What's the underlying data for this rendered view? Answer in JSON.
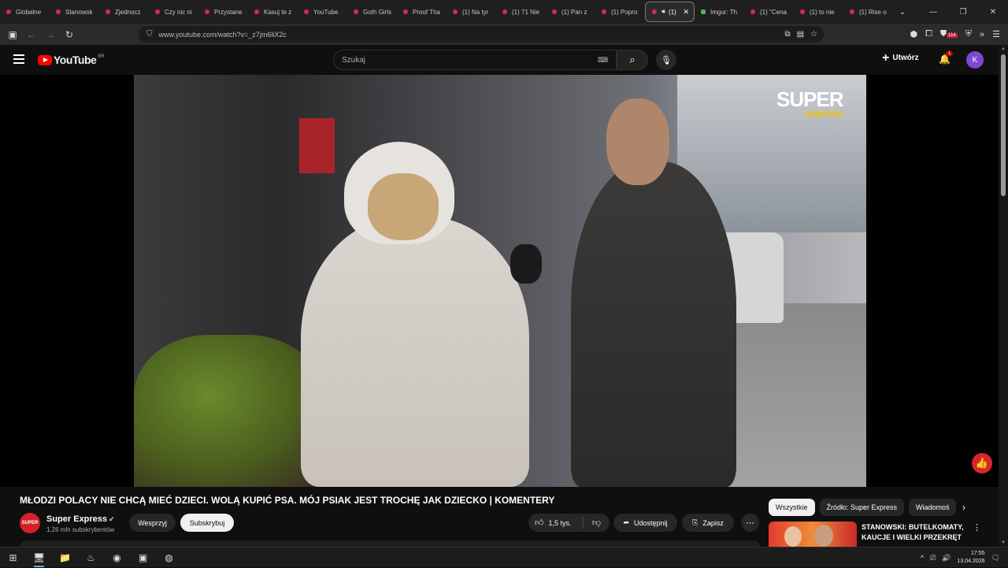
{
  "browser": {
    "tabs": [
      {
        "label": "Globalne",
        "icon": "youtube-icon"
      },
      {
        "label": "Stanowsk",
        "icon": "youtube-icon"
      },
      {
        "label": "Zjednocz",
        "icon": "youtube-icon"
      },
      {
        "label": "Czy nic ni",
        "icon": "youtube-icon"
      },
      {
        "label": "Przystane",
        "icon": "youtube-icon"
      },
      {
        "label": "Kasuj te z",
        "icon": "youtube-icon"
      },
      {
        "label": "YouTube",
        "icon": "youtube-icon"
      },
      {
        "label": "Goth Girls",
        "icon": "youtube-icon"
      },
      {
        "label": "Proof Tha",
        "icon": "youtube-icon"
      },
      {
        "label": "(1) Na tyr",
        "icon": "youtube-icon"
      },
      {
        "label": "(1) 71 Nie",
        "icon": "youtube-icon"
      },
      {
        "label": "(1) Pan z",
        "icon": "youtube-icon"
      },
      {
        "label": "(1) Popro",
        "icon": "youtube-icon"
      },
      {
        "label": "(1)",
        "icon": "youtube-icon",
        "active": true
      },
      {
        "label": "Imgur: Th",
        "icon": "imgur-icon"
      },
      {
        "label": "(1) \"Cena",
        "icon": "youtube-icon"
      },
      {
        "label": "(1) to nie",
        "icon": "youtube-icon"
      },
      {
        "label": "(1) Rise o",
        "icon": "youtube-icon"
      }
    ],
    "url": "www.youtube.com/watch?v=_z7jm6liX2c",
    "extension_badge": "114"
  },
  "youtube": {
    "logo_text": "YouTube",
    "logo_country": "BR",
    "search_placeholder": "Szukaj",
    "create_label": "Utwórz",
    "notification_count": "1",
    "avatar_letter": "K"
  },
  "video": {
    "watermark_line1": "SUPER",
    "watermark_line2": "express",
    "title": "MŁODZI POLACY NIE CHCĄ MIEĆ DZIECI. WOLĄ KUPIĆ PSA. MÓJ PSIAK JEST TROCHĘ JAK DZIECKO | KOMENTERY",
    "channel_name": "Super Express",
    "channel_icon_text": "SUPER",
    "subscribers": "1,26 mln subskrybentów",
    "support_label": "Wesprzyj",
    "subscribe_label": "Subskrybuj",
    "likes": "1,5 tys.",
    "share_label": "Udostępnij",
    "save_label": "Zapisz"
  },
  "sidebar": {
    "chips": [
      "Wszystkie",
      "Źródło: Super Express",
      "Wiadomoś"
    ],
    "recommended_title": "STANOWSKI: BUTELKOMATY, KAUCJE I WIELKI PRZEKRĘT"
  },
  "taskbar": {
    "time": "17:55",
    "date": "13.04.2026"
  }
}
